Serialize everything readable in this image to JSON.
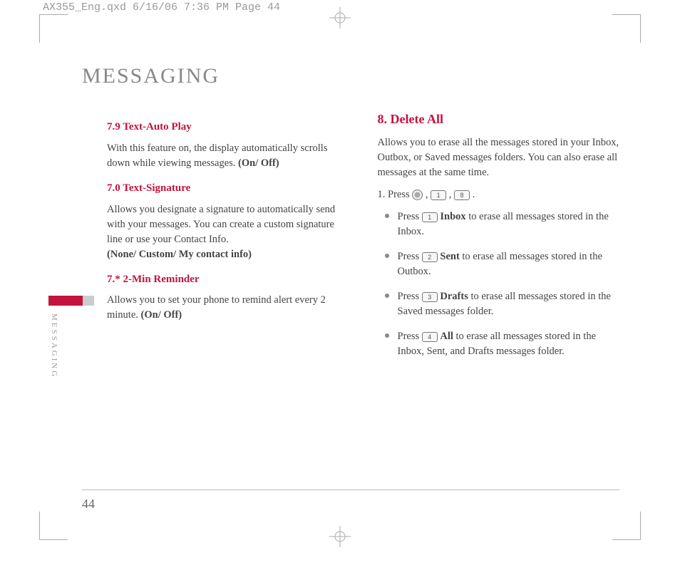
{
  "cropHeader": "AX355_Eng.qxd  6/16/06  7:36 PM  Page 44",
  "mainTitle": "MESSAGING",
  "sideLabel": "MESSAGING",
  "pageNum": "44",
  "left": {
    "s1": {
      "title": "7.9 Text-Auto Play",
      "body": "With this feature on, the display automatically scrolls down while viewing messages. ",
      "opt": "(On/ Off)"
    },
    "s2": {
      "title": "7.0 Text-Signature",
      "body": "Allows you designate a signature to automatically send with your messages. You can create a custom signature line or use your Contact Info.",
      "opt": "(None/ Custom/ My contact info)"
    },
    "s3": {
      "title": "7.* 2-Min Reminder",
      "body": "Allows you to set your phone to remind alert every 2 minute. ",
      "opt": "(On/ Off)"
    }
  },
  "right": {
    "title": "8. Delete All",
    "intro": "Allows you to erase all the messages stored in your Inbox, Outbox, or Saved messages folders. You can also erase all messages at the same time.",
    "stepPrefix": "1. Press ",
    "keys": {
      "k1": "1",
      "k8": "8",
      "k2": "2",
      "k3": "3",
      "k4": "4"
    },
    "b1": {
      "p": "Press ",
      "bold": "Inbox",
      "rest": " to erase all messages stored in the Inbox."
    },
    "b2": {
      "p": "Press ",
      "bold": "Sent",
      "rest": " to erase all messages stored in the Outbox."
    },
    "b3": {
      "p": "Press ",
      "bold": "Drafts",
      "rest": " to erase all messages stored in the Saved messages folder."
    },
    "b4": {
      "p": "Press ",
      "bold": "All",
      "rest": " to erase all messages stored in the Inbox, Sent, and Drafts messages folder."
    }
  }
}
